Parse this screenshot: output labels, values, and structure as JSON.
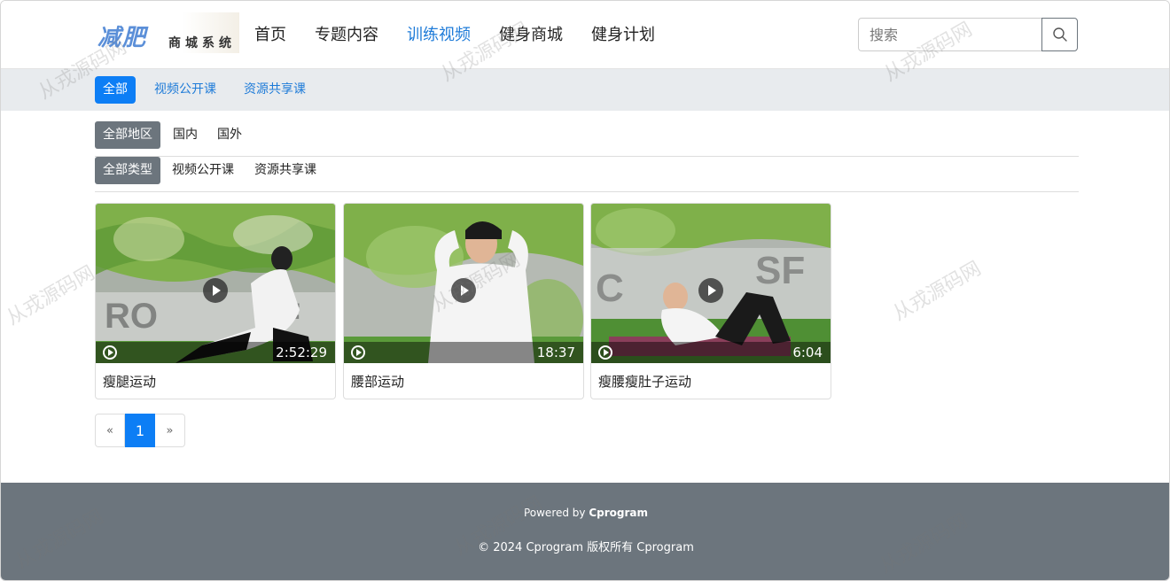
{
  "header": {
    "logo_main": "减肥",
    "logo_sub": "商城系统",
    "nav": [
      {
        "label": "首页",
        "active": false
      },
      {
        "label": "专题内容",
        "active": false
      },
      {
        "label": "训练视频",
        "active": true
      },
      {
        "label": "健身商城",
        "active": false
      },
      {
        "label": "健身计划",
        "active": false
      }
    ],
    "search": {
      "placeholder": "搜索",
      "value": "",
      "icon": "search-icon"
    }
  },
  "category_tabs": [
    {
      "label": "全部",
      "active": true
    },
    {
      "label": "视频公开课",
      "active": false
    },
    {
      "label": "资源共享课",
      "active": false
    }
  ],
  "filters": {
    "region": [
      {
        "label": "全部地区",
        "active": true
      },
      {
        "label": "国内",
        "active": false
      },
      {
        "label": "国外",
        "active": false
      }
    ],
    "type": [
      {
        "label": "全部类型",
        "active": true
      },
      {
        "label": "视频公开课",
        "active": false
      },
      {
        "label": "资源共享课",
        "active": false
      }
    ]
  },
  "videos": [
    {
      "title": "瘦腿运动",
      "duration": "2:52:29"
    },
    {
      "title": "腰部运动",
      "duration": "18:37"
    },
    {
      "title": "瘦腰瘦肚子运动",
      "duration": "6:04"
    }
  ],
  "pagination": {
    "prev": "«",
    "current": "1",
    "next": "»"
  },
  "footer": {
    "powered_prefix": "Powered by ",
    "powered_brand": "Cprogram",
    "copyright": "© 2024 Cprogram 版权所有 Cprogram"
  },
  "watermark": "从戎源码网",
  "colors": {
    "accent": "#0d7ef5",
    "nav_active": "#1e7bd8",
    "footer_bg": "#6c757d",
    "catbar_bg": "#e8ebee"
  }
}
